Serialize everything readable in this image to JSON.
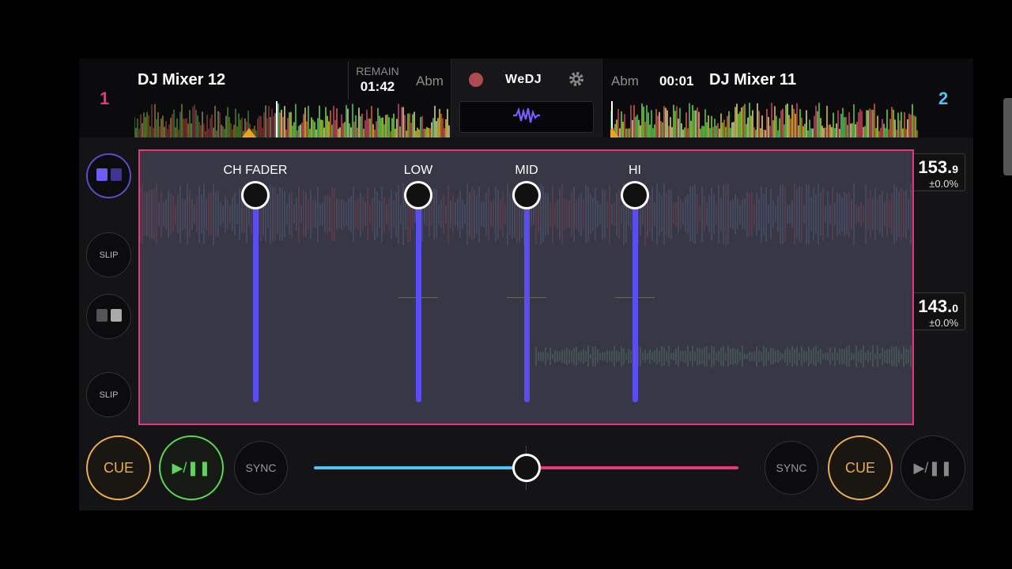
{
  "deck1": {
    "number": "1",
    "title": "DJ Mixer 12",
    "remain_label": "REMAIN",
    "remain_time": "01:42",
    "key": "Abm",
    "bpm_main": "153.",
    "bpm_decimal": "9",
    "pitch": "±0.0%",
    "color": "#e8367a"
  },
  "deck2": {
    "number": "2",
    "title": "DJ Mixer 11",
    "time": "00:01",
    "key": "Abm",
    "bpm_main": "143.",
    "bpm_decimal": "0",
    "pitch": "±0.0%",
    "color": "#4fc3f7"
  },
  "center": {
    "brand": "WeDJ",
    "icons": [
      "record-icon",
      "gear-icon",
      "waveform-icon"
    ]
  },
  "side_buttons": {
    "slip_1": "SLIP",
    "slip_2": "SLIP"
  },
  "mixer": {
    "faders": [
      {
        "label": "CH FADER",
        "level": 1.0
      },
      {
        "label": "LOW",
        "level": 1.0
      },
      {
        "label": "MID",
        "level": 1.0
      },
      {
        "label": "HI",
        "level": 1.0
      }
    ]
  },
  "bottom": {
    "cue_1": "CUE",
    "play_1": "▶/❚❚",
    "sync_1": "SYNC",
    "sync_2": "SYNC",
    "cue_2": "CUE",
    "play_2": "▶/❚❚"
  },
  "crossfader": {
    "position": 0.5
  }
}
